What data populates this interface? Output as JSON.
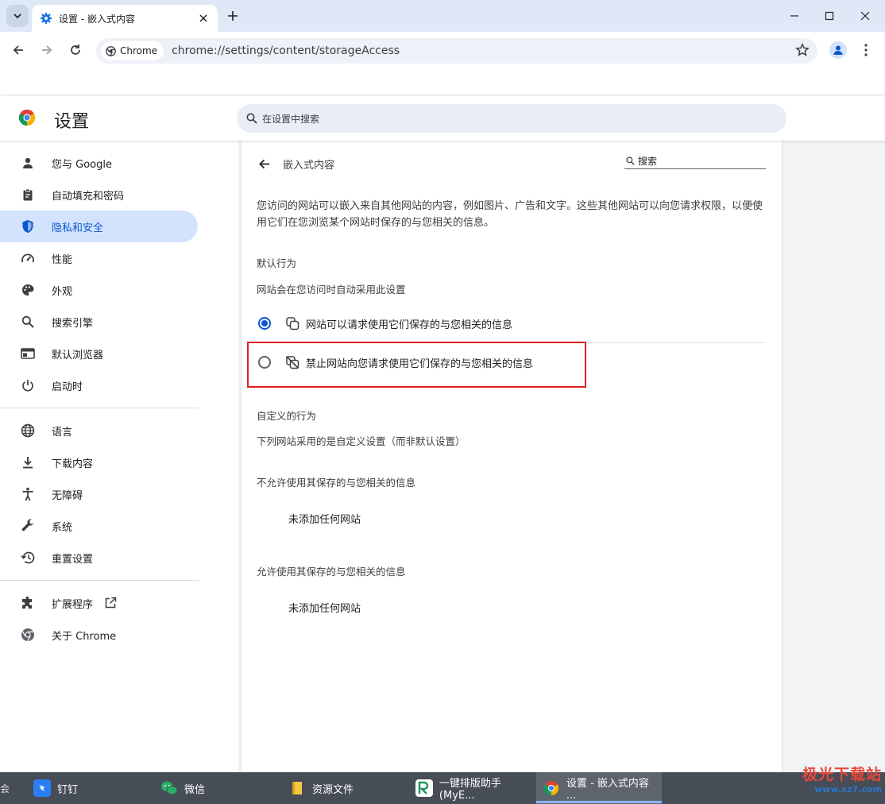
{
  "browser": {
    "tab_title": "设置 - 嵌入式内容",
    "url_chip": "Chrome",
    "url": "chrome://settings/content/storageAccess"
  },
  "settings_header": {
    "title": "设置",
    "search_placeholder": "在设置中搜索"
  },
  "sidebar": {
    "items": [
      {
        "label": "您与 Google",
        "icon": "person-icon"
      },
      {
        "label": "自动填充和密码",
        "icon": "clipboard-icon"
      },
      {
        "label": "隐私和安全",
        "icon": "shield-icon",
        "active": true
      },
      {
        "label": "性能",
        "icon": "speedometer-icon"
      },
      {
        "label": "外观",
        "icon": "palette-icon"
      },
      {
        "label": "搜索引擎",
        "icon": "search-icon"
      },
      {
        "label": "默认浏览器",
        "icon": "browser-window-icon"
      },
      {
        "label": "启动时",
        "icon": "power-icon"
      },
      {
        "label": "语言",
        "icon": "globe-icon"
      },
      {
        "label": "下载内容",
        "icon": "download-icon"
      },
      {
        "label": "无障碍",
        "icon": "accessibility-icon"
      },
      {
        "label": "系统",
        "icon": "wrench-icon"
      },
      {
        "label": "重置设置",
        "icon": "history-icon"
      },
      {
        "label": "扩展程序",
        "icon": "puzzle-icon"
      },
      {
        "label": "关于 Chrome",
        "icon": "chrome-icon"
      }
    ]
  },
  "content": {
    "title": "嵌入式内容",
    "search_placeholder": "搜索",
    "description": "您访问的网站可以嵌入来自其他网站的内容，例如图片、广告和文字。这些其他网站可以向您请求权限，以便使用它们在您浏览某个网站时保存的与您相关的信息。",
    "default_heading": "默认行为",
    "default_sub": "网站会在您访问时自动采用此设置",
    "option_allow": "网站可以请求使用它们保存的与您相关的信息",
    "option_block": "禁止网站向您请求使用它们保存的与您相关的信息",
    "custom_heading": "自定义的行为",
    "custom_sub": "下列网站采用的是自定义设置（而非默认设置）",
    "blocked_heading": "不允许使用其保存的与您相关的信息",
    "blocked_empty": "未添加任何网站",
    "allowed_heading": "允许使用其保存的与您相关的信息",
    "allowed_empty": "未添加任何网站"
  },
  "taskbar": {
    "items": [
      "钉钉",
      "微信",
      "资源文件",
      "一键排版助手(MyE...",
      "设置 - 嵌入式内容 ..."
    ],
    "left_fragment": "会"
  },
  "watermark": {
    "top": "极光下载站",
    "bottom": "www.xz7.com"
  }
}
